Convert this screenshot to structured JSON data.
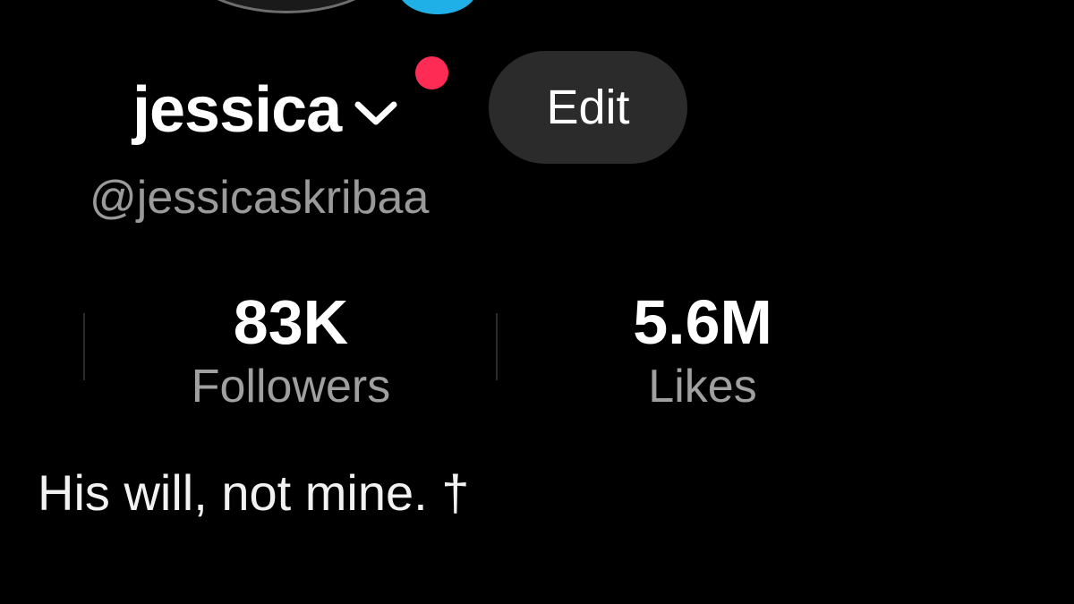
{
  "profile": {
    "display_name": "jessica",
    "handle": "@jessicaskribaa",
    "bio": "His will, not mine. †"
  },
  "actions": {
    "edit_label": "Edit"
  },
  "stats": {
    "followers": {
      "value": "83K",
      "label": "Followers"
    },
    "likes": {
      "value": "5.6M",
      "label": "Likes"
    }
  },
  "colors": {
    "background": "#000000",
    "notification_dot": "#fe2c55",
    "edit_button_bg": "#2b2b2b",
    "secondary_text": "#9a9a9a",
    "avatar_badge": "#20b0e8"
  },
  "icons": {
    "name_dropdown": "chevron-down-icon"
  }
}
